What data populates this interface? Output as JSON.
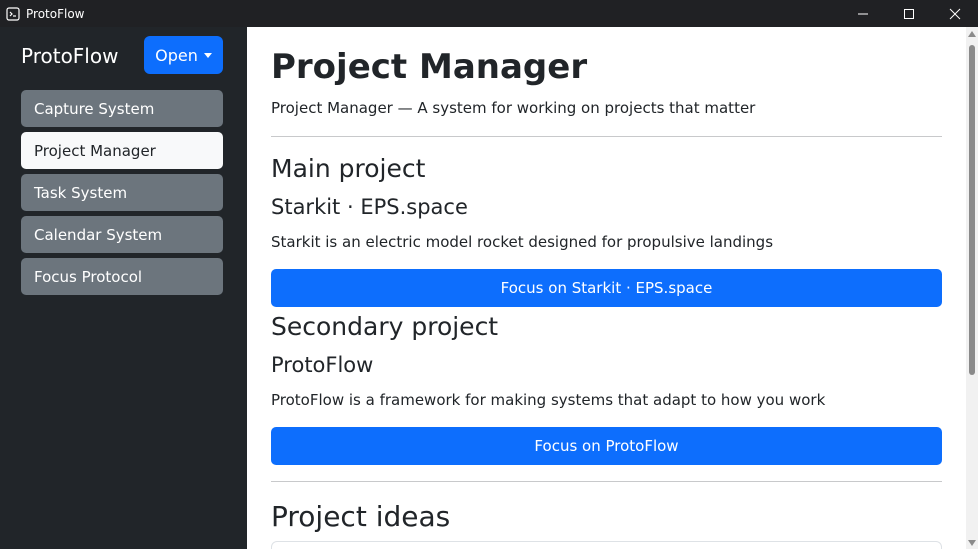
{
  "window": {
    "title": "ProtoFlow",
    "controls": [
      "minimize-icon",
      "maximize-icon",
      "close-icon"
    ]
  },
  "sidebar": {
    "brand": "ProtoFlow",
    "open_button": "Open",
    "items": [
      {
        "label": "Capture System",
        "active": false
      },
      {
        "label": "Project Manager",
        "active": true
      },
      {
        "label": "Task System",
        "active": false
      },
      {
        "label": "Calendar System",
        "active": false
      },
      {
        "label": "Focus Protocol",
        "active": false
      }
    ]
  },
  "main": {
    "title": "Project Manager",
    "lead": "Project Manager — A system for working on projects that matter",
    "main_project": {
      "heading": "Main project",
      "name": "Starkit · EPS.space",
      "description": "Starkit is an electric model rocket designed for propulsive landings",
      "button": "Focus on Starkit · EPS.space"
    },
    "secondary_project": {
      "heading": "Secondary project",
      "name": "ProtoFlow",
      "description": "ProtoFlow is a framework for making systems that adapt to how you work",
      "button": "Focus on ProtoFlow"
    },
    "ideas_heading": "Project ideas"
  },
  "colors": {
    "accent": "#0d6efd",
    "sidebar_bg": "#212529",
    "nav_item_bg": "#6c757d",
    "nav_item_active_bg": "#f8f9fa",
    "titlebar_bg": "#202124"
  }
}
